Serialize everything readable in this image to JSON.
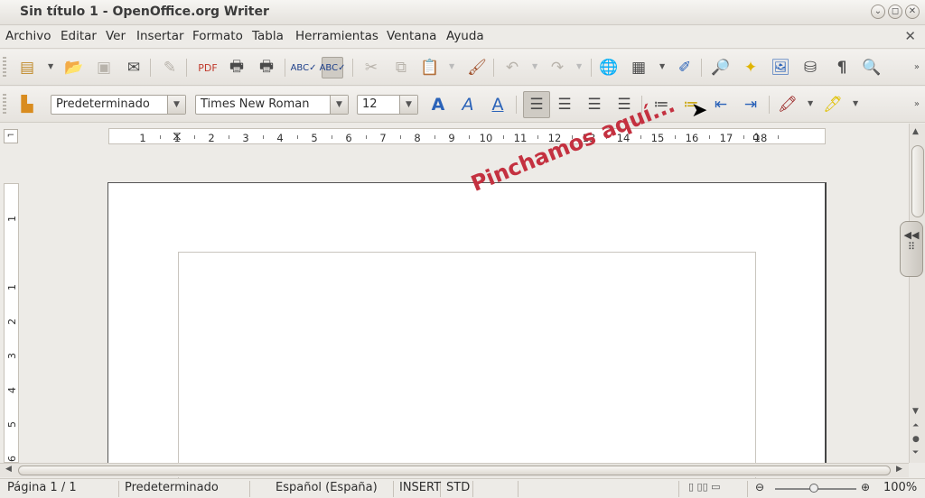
{
  "window": {
    "title": "Sin título 1 - OpenOffice.org Writer"
  },
  "menu": {
    "items": [
      "Archivo",
      "Editar",
      "Ver",
      "Insertar",
      "Formato",
      "Tabla",
      "Herramientas",
      "Ventana",
      "Ayuda"
    ]
  },
  "formatting": {
    "paragraph_style": "Predeterminado",
    "font_name": "Times New Roman",
    "font_size": "12"
  },
  "ruler": {
    "h_ticks": [
      "1",
      "1",
      "2",
      "3",
      "4",
      "5",
      "6",
      "7",
      "8",
      "9",
      "10",
      "11",
      "12",
      "13",
      "14",
      "15",
      "16",
      "17",
      "18"
    ],
    "v_ticks": [
      "1",
      "1",
      "2",
      "3",
      "4",
      "5",
      "6"
    ]
  },
  "annotation": {
    "text": "Pinchamos aquí..."
  },
  "status": {
    "page": "Página  1 / 1",
    "style": "Predeterminado",
    "language": "Español (España)",
    "insert_mode": "INSERT",
    "selection_mode": "STD",
    "zoom": "100%"
  },
  "colors": {
    "annotation": "#c43140",
    "toolbar_bg": "#e6e3de"
  }
}
